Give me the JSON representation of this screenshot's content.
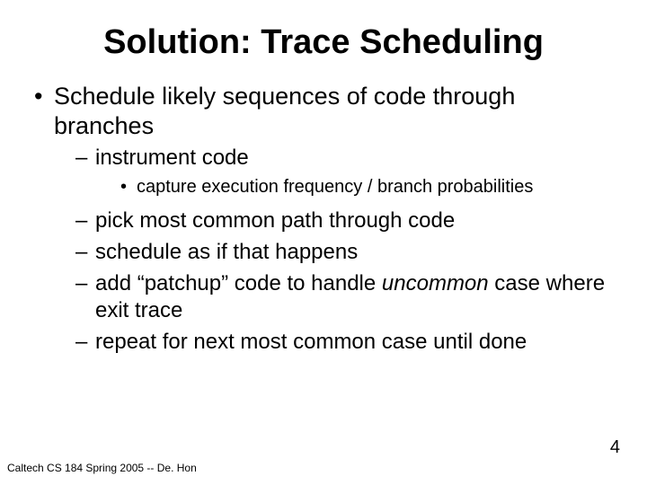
{
  "title": "Solution: Trace Scheduling",
  "bullets": {
    "b1": "Schedule likely sequences of code through branches",
    "b1_1": "instrument code",
    "b1_1_1": "capture execution frequency / branch probabilities",
    "b1_2": "pick most common path through code",
    "b1_3": "schedule as if that happens",
    "b1_4_a": "add “patchup” code to handle ",
    "b1_4_b": "uncommon",
    "b1_4_c": " case where exit trace",
    "b1_5": "repeat for next most common case until done"
  },
  "footer": "Caltech CS 184 Spring 2005 -- De. Hon",
  "page_number": "4"
}
